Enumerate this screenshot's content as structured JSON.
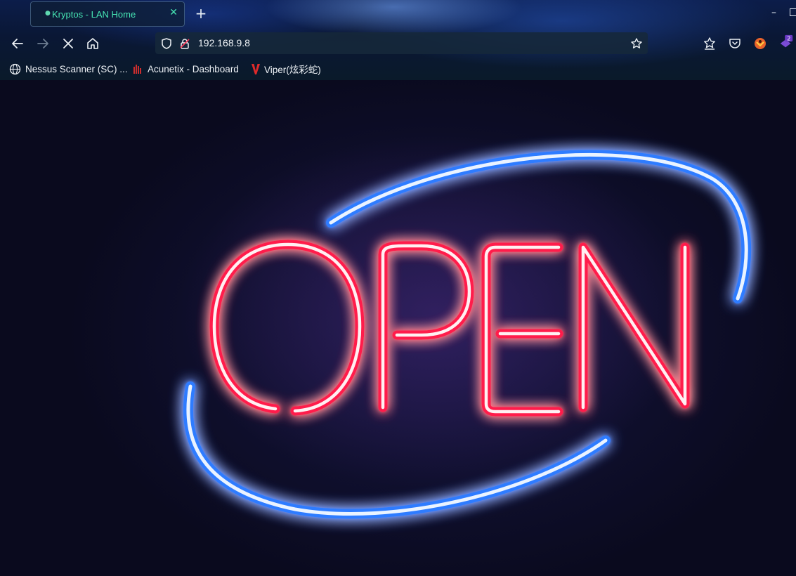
{
  "browser": {
    "tab": {
      "title": "Kryptos - LAN Home"
    },
    "address_bar": {
      "url": "192.168.9.8"
    },
    "extension_badge": "2",
    "bookmarks": [
      {
        "label": "Nessus Scanner (SC) ...",
        "icon": "globe-icon"
      },
      {
        "label": "Acunetix - Dashboard",
        "icon": "acunetix-icon"
      },
      {
        "label": "Viper(炫彩蛇)",
        "icon": "viper-icon"
      }
    ]
  },
  "page": {
    "sign_text": "OPEN",
    "colors": {
      "neon_red": "#ff1f4b",
      "neon_blue": "#2f7bff",
      "tab_accent": "#46e6b4"
    }
  }
}
